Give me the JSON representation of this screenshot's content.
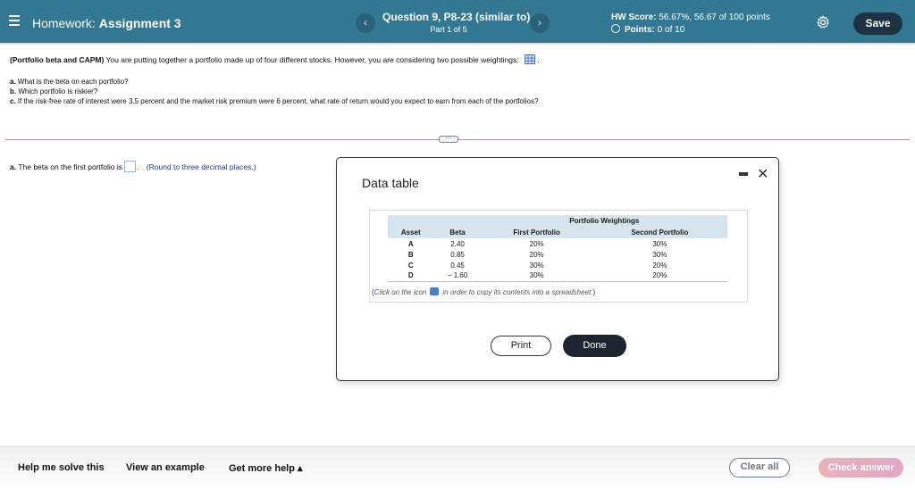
{
  "header": {
    "menu_icon": "hamburger-menu-icon",
    "title_prefix": "Homework:",
    "title_name": "Assignment 3",
    "prev_label": "‹",
    "next_label": "›",
    "question_title": "Question 9, P8-23 (similar to)",
    "question_part": "Part 1 of 5",
    "hw_score_label": "HW Score:",
    "hw_score_value": "56.67%, 56.67 of 100 points",
    "points_label": "Points:",
    "points_value": "0 of 10",
    "settings_icon": "gear-icon",
    "save_label": "Save"
  },
  "problem": {
    "topic": "(Portfolio beta and CAPM)",
    "statement": "You are putting together a portfolio made up of four different stocks.  However, you are considering two possible weightings:",
    "data_icon": "data-table-grid-icon",
    "questions": [
      {
        "letter": "a.",
        "text": "What is the beta on each portfolio?"
      },
      {
        "letter": "b.",
        "text": "Which portfolio is riskier?"
      },
      {
        "letter": "c.",
        "text": "If the risk-free rate of interest were 3.5 percent and the market risk premium were 6 percent, what rate of return would you expect to earn from each of the portfolios?"
      }
    ],
    "expand_label": "···"
  },
  "answer": {
    "letter": "a.",
    "prefix": "The beta on the first portfolio is",
    "input_value": "",
    "suffix": ".",
    "hint": "(Round to three decimal places.)"
  },
  "modal": {
    "title": "Data table",
    "minimize_icon": "minimize-icon",
    "close_label": "✕",
    "group_header": "Portfolio Weightings",
    "columns": [
      "Asset",
      "Beta",
      "First Portfolio",
      "Second Portfolio"
    ],
    "rows": [
      [
        "A",
        "2.40",
        "20%",
        "30%"
      ],
      [
        "B",
        "0.85",
        "20%",
        "30%"
      ],
      [
        "C",
        "0.45",
        "30%",
        "20%"
      ],
      [
        "D",
        "− 1.60",
        "30%",
        "20%"
      ]
    ],
    "note_open": "(",
    "note_before": "Click on the icon",
    "note_after": "in order to copy its contents into a spreadsheet.",
    "note_close": ")",
    "print_label": "Print",
    "done_label": "Done"
  },
  "footer": {
    "help_solve": "Help me solve this",
    "view_example": "View an example",
    "more_help": "Get more help ▴",
    "clear_all": "Clear all",
    "check_answer": "Check answer"
  }
}
